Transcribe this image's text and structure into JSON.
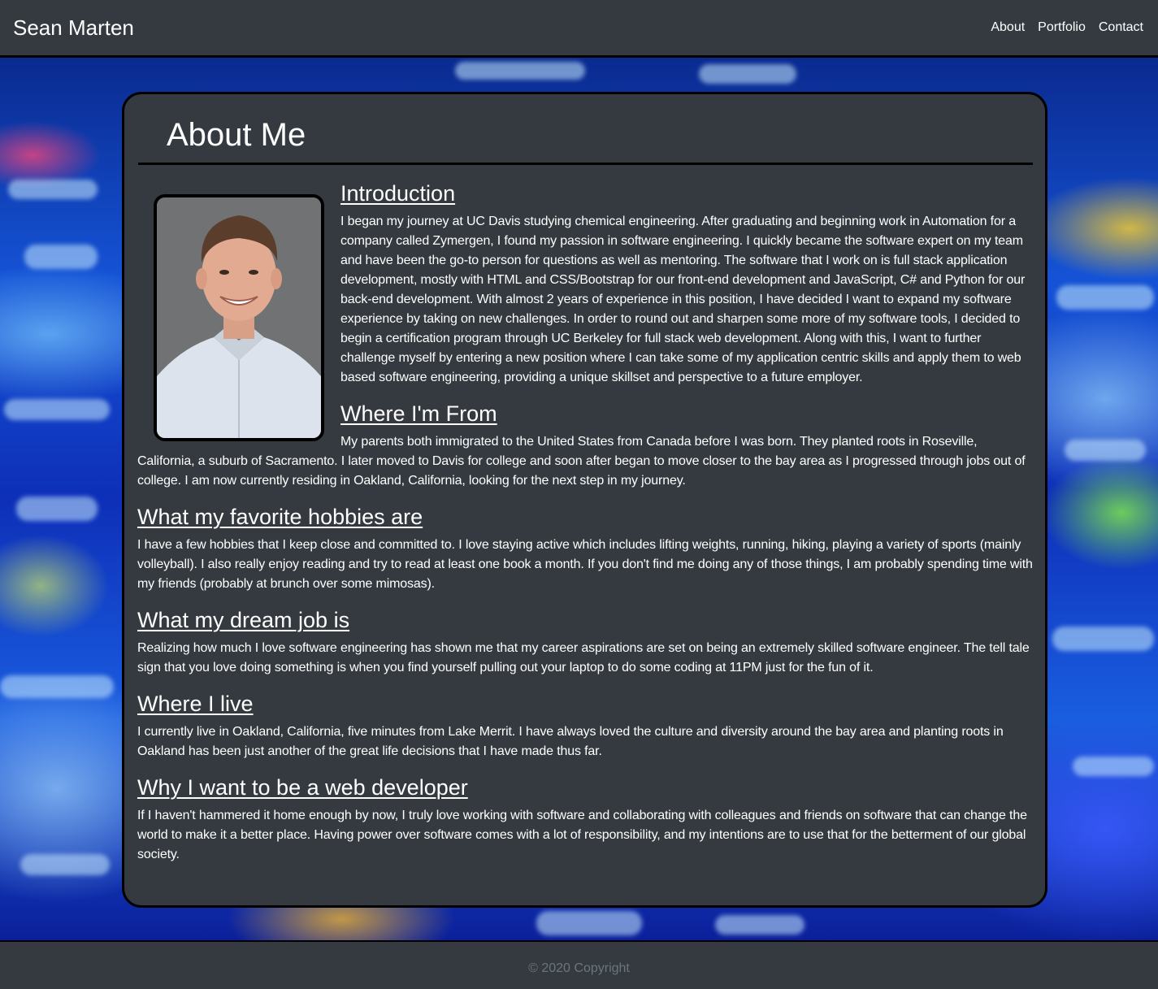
{
  "navbar": {
    "brand": "Sean Marten",
    "links": [
      "About",
      "Portfolio",
      "Contact"
    ]
  },
  "about": {
    "title": "About Me",
    "portrait_alt": "Photo of Sean Marten",
    "sections": [
      {
        "heading": "Introduction",
        "text": "I began my journey at UC Davis studying chemical engineering. After graduating and beginning work in Automation for a company called Zymergen, I found my passion in software engineering. I quickly became the software expert on my team and have been the go-to person for questions as well as mentoring. The software that I work on is full stack application development, mostly with HTML and CSS/Bootstrap for our front-end development and JavaScript, C# and Python for our back-end development. With almost 2 years of experience in this position, I have decided I want to expand my software experience by taking on new challenges. In order to round out and sharpen some more of my software tools, I decided to begin a certification program through UC Berkeley for full stack web development. Along with this, I want to further challenge myself by entering a new position where I can take some of my application centric skills and apply them to web based software engineering, providing a unique skillset and perspective to a future employer."
      },
      {
        "heading": "Where I'm From",
        "text": "My parents both immigrated to the United States from Canada before I was born. They planted roots in Roseville, California, a suburb of Sacramento. I later moved to Davis for college and soon after began to move closer to the bay area as I progressed through jobs out of college. I am now currently residing in Oakland, California, looking for the next step in my journey."
      },
      {
        "heading": "What my favorite hobbies are",
        "text": "I have a few hobbies that I keep close and committed to. I love staying active which includes lifting weights, running, hiking, playing a variety of sports (mainly volleyball). I also really enjoy reading and try to read at least one book a month. If you don't find me doing any of those things, I am probably spending time with my friends (probably at brunch over some mimosas)."
      },
      {
        "heading": "What my dream job is",
        "text": "Realizing how much I love software engineering has shown me that my career aspirations are set on being an extremely skilled software engineer. The tell tale sign that you love doing something is when you find yourself pulling out your laptop to do some coding at 11PM just for the fun of it."
      },
      {
        "heading": "Where I live",
        "text": "I currently live in Oakland, California, five minutes from Lake Merrit. I have always loved the culture and diversity around the bay area and planting roots in Oakland has been just another of the great life decisions that I have made thus far."
      },
      {
        "heading": "Why I want to be a web developer",
        "text": "If I haven't hammered it home enough by now, I truly love working with software and collaborating with colleagues and friends on software that can change the world to make it a better place. Having power over software comes with a lot of responsibility, and my intentions are to use that for the betterment of our global society."
      }
    ]
  },
  "footer": {
    "copyright": "© 2020 Copyright"
  },
  "colors": {
    "surface": "#343a40",
    "border": "#000000",
    "text": "#ffffff",
    "muted": "#6c757d"
  }
}
